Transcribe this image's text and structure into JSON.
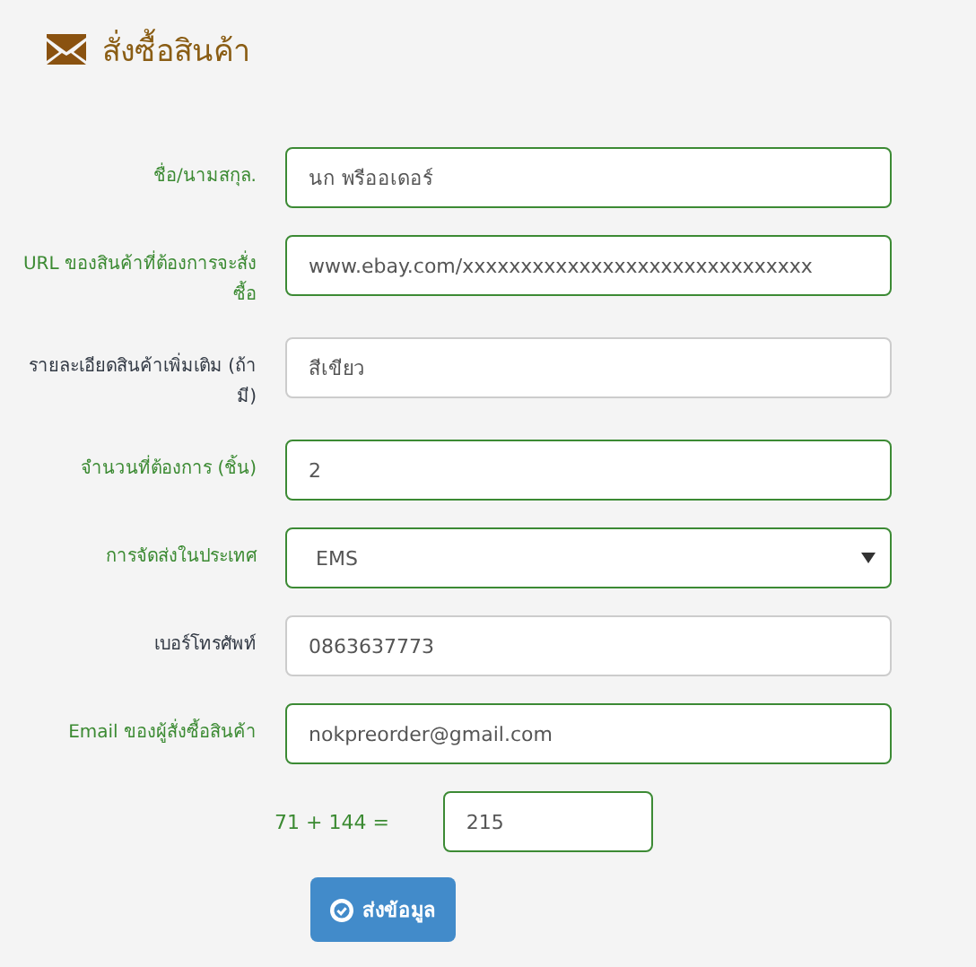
{
  "title": "สั่งซื้อสินค้า",
  "fields": [
    {
      "kind": "text",
      "label": "ชื่อ/นามสกุล.",
      "value": "นก พรีออเดอร์",
      "valid": true
    },
    {
      "kind": "text",
      "label": "URL ของสินค้าที่ต้องการจะสั่งซื้อ",
      "value": "www.ebay.com/xxxxxxxxxxxxxxxxxxxxxxxxxxxxxx",
      "valid": true
    },
    {
      "kind": "text",
      "label": "รายละเอียดสินค้าเพิ่มเติม (ถ้ามี)",
      "value": "สีเขียว",
      "valid": false
    },
    {
      "kind": "text",
      "label": "จำนวนที่ต้องการ (ชิ้น)",
      "value": "2",
      "valid": true
    },
    {
      "kind": "select",
      "label": "การจัดส่งในประเทศ",
      "value": "EMS",
      "valid": true
    },
    {
      "kind": "text",
      "label": "เบอร์โทรศัพท์",
      "value": "0863637773",
      "valid": false
    },
    {
      "kind": "text",
      "label": "Email ของผู้สั่งซื้อสินค้า",
      "value": "nokpreorder@gmail.com",
      "valid": true
    }
  ],
  "captcha": {
    "question": "71 + 144 =",
    "value": "215",
    "valid": true
  },
  "submit": "ส่งข้อมูล"
}
